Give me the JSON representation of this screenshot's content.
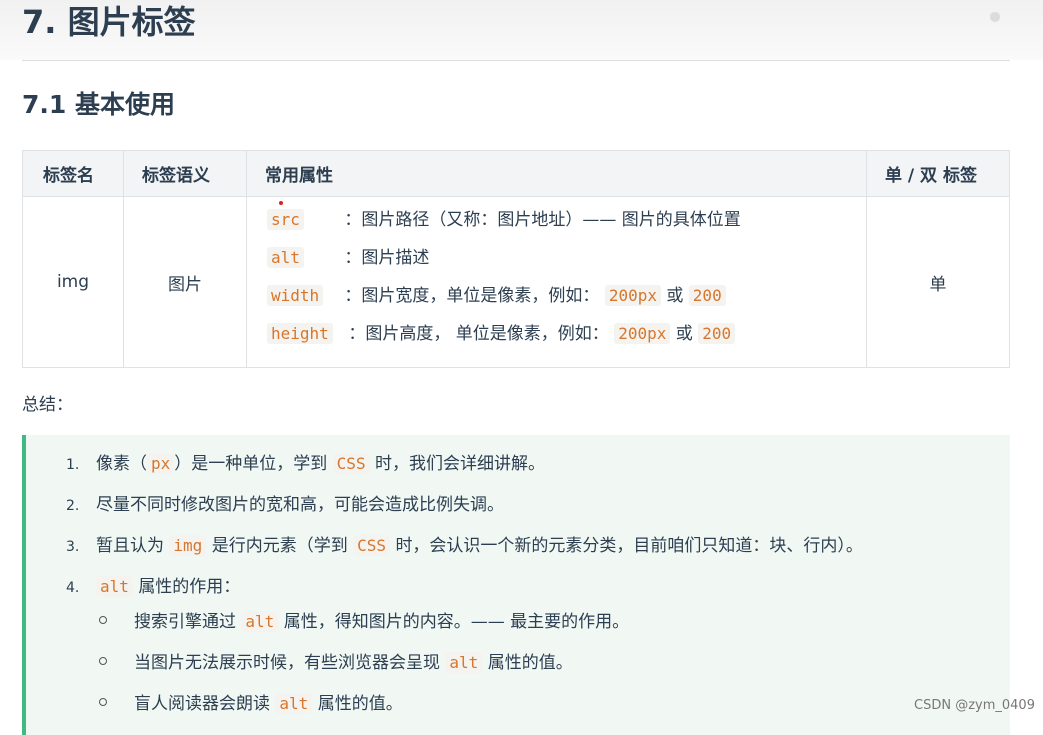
{
  "heading": "7. 图片标签",
  "subheading": "7.1 基本使用",
  "table": {
    "headers": [
      "标签名",
      "标签语义",
      "常用属性",
      "单 / 双 标签"
    ],
    "row": {
      "tag": "img",
      "meaning": "图片",
      "type": "单",
      "attrs": [
        {
          "name": "src",
          "desc": "：图片路径（又称：图片地址）—— 图片的具体位置"
        },
        {
          "name": "alt",
          "desc": "：图片描述"
        },
        {
          "name": "width",
          "desc": "：图片宽度，单位是像素，例如：",
          "v1": "200px",
          "or": "或",
          "v2": "200"
        },
        {
          "name": "height",
          "desc": "：图片高度， 单位是像素，例如：",
          "v1": "200px",
          "or": "或",
          "v2": "200"
        }
      ]
    }
  },
  "summary": {
    "label": "总结：",
    "items": [
      {
        "num": "1.",
        "a": "像素（",
        "code": "px",
        "b": "）是一种单位，学到",
        "code2": "CSS",
        "c": "时，我们会详细讲解。"
      },
      {
        "num": "2.",
        "text": "尽量不同时修改图片的宽和高，可能会造成比例失调。"
      },
      {
        "num": "3.",
        "a": "暂且认为",
        "code": "img",
        "b": "是行内元素（学到",
        "code2": "CSS",
        "c": "时，会认识一个新的元素分类，目前咱们只知道：块、行内）。"
      },
      {
        "num": "4.",
        "code": "alt",
        "b": "属性的作用："
      }
    ],
    "sub": [
      {
        "a": "搜索引擎通过",
        "code": "alt",
        "b": "属性，得知图片的内容。—— 最主要的作用。"
      },
      {
        "a": "当图片无法展示时候，有些浏览器会呈现",
        "code": "alt",
        "b": "属性的值。"
      },
      {
        "a": "盲人阅读器会朗读",
        "code": "alt",
        "b": "属性的值。"
      }
    ]
  },
  "watermark": "CSDN @zym_0409"
}
